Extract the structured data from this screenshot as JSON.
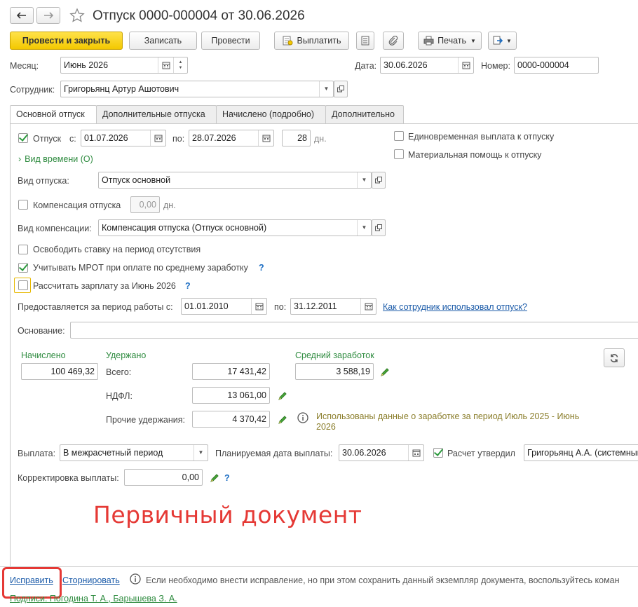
{
  "window": {
    "title": "Отпуск 0000-000004 от 30.06.2026"
  },
  "toolbar": {
    "post_close": "Провести и закрыть",
    "save": "Записать",
    "post": "Провести",
    "pay": "Выплатить",
    "print": "Печать"
  },
  "header": {
    "month_label": "Месяц:",
    "month_value": "Июнь 2026",
    "date_label": "Дата:",
    "date_value": "30.06.2026",
    "number_label": "Номер:",
    "number_value": "0000-000004",
    "employee_label": "Сотрудник:",
    "employee_value": "Григорьянц Артур Ашотович"
  },
  "tabs": [
    "Основной отпуск",
    "Дополнительные отпуска",
    "Начислено (подробно)",
    "Дополнительно"
  ],
  "main": {
    "leave_label": "Отпуск",
    "from_label": "с:",
    "from_value": "01.07.2026",
    "to_label": "по:",
    "to_value": "28.07.2026",
    "days_value": "28",
    "days_unit": "дн.",
    "time_type_link": "Вид времени (О)",
    "lump_sum": "Единовременная выплата к отпуску",
    "material_aid": "Материальная помощь к отпуску",
    "leave_type_label": "Вид отпуска:",
    "leave_type_value": "Отпуск основной",
    "compensation_label": "Компенсация отпуска",
    "compensation_days": "0,00",
    "compensation_unit": "дн.",
    "comp_type_label": "Вид компенсации:",
    "comp_type_value": "Компенсация отпуска (Отпуск основной)",
    "free_rate": "Освободить ставку на период отсутствия",
    "mrot": "Учитывать МРОТ при оплате по среднему заработку",
    "calc_salary": "Рассчитать зарплату за Июнь 2026",
    "help_mark": "?",
    "period_label": "Предоставляется за период работы с:",
    "period_from": "01.01.2010",
    "period_to_label": "по:",
    "period_to": "31.12.2011",
    "usage_link": "Как сотрудник использовал отпуск?",
    "basis_label": "Основание:",
    "basis_value": ""
  },
  "totals": {
    "accrued_label": "Начислено",
    "accrued_value": "100 469,32",
    "withheld_label": "Удержано",
    "total_label": "Всего:",
    "total_value": "17 431,42",
    "ndfl_label": "НДФЛ:",
    "ndfl_value": "13 061,00",
    "other_label": "Прочие удержания:",
    "other_value": "4 370,42",
    "avg_label": "Средний заработок",
    "avg_value": "3 588,19",
    "earnings_note": "Использованы данные о заработке за период Июль 2025 - Июнь 2026"
  },
  "payment": {
    "payout_label": "Выплата:",
    "payout_value": "В межрасчетный период",
    "planned_label": "Планируемая дата выплаты:",
    "planned_value": "30.06.2026",
    "approved_label": "Расчет утвердил",
    "approved_value": "Григорьянц А.А. (системный",
    "adjust_label": "Корректировка выплаты:",
    "adjust_value": "0,00"
  },
  "annotation": "Первичный документ",
  "footer": {
    "fix_link": "Исправить",
    "reverse_link": "Сторнировать",
    "info_text": "Если необходимо внести исправление, но при этом сохранить данный экземпляр документа, воспользуйтесь коман",
    "signatures_link": "Подписи: Погодина Т. А., Барышева З. А."
  },
  "colors": {
    "primary_button": "#f3c800",
    "accent_green": "#2e8b3f",
    "link_blue": "#1a5aa8",
    "annotation_red": "#e53935"
  }
}
